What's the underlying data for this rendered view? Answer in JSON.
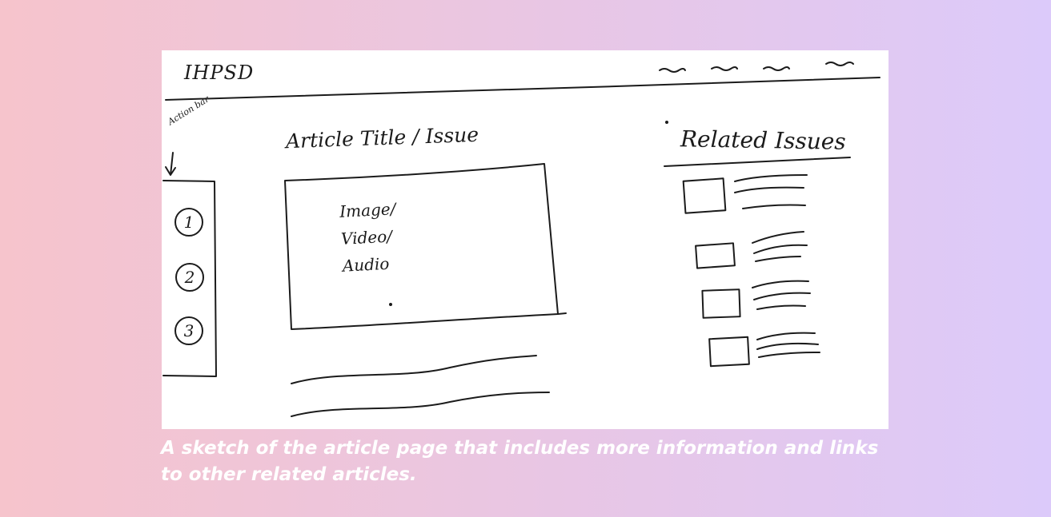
{
  "sketch": {
    "logo": "IHPSD",
    "article_title": "Article Title / Issue",
    "related_title": "Related Issues",
    "action_bar_label": "Action bar",
    "media_placeholder": [
      "Image/",
      "Video/",
      "Audio"
    ],
    "action_items": [
      "1",
      "2",
      "3"
    ]
  },
  "caption": "A sketch of the article page that includes more information and links to other related articles.",
  "colors": {
    "ink": "#1b1b1b",
    "paper": "#ffffff",
    "caption_text": "#ffffff",
    "gradient_left": "#f6c4cc",
    "gradient_right": "#dccafa"
  }
}
